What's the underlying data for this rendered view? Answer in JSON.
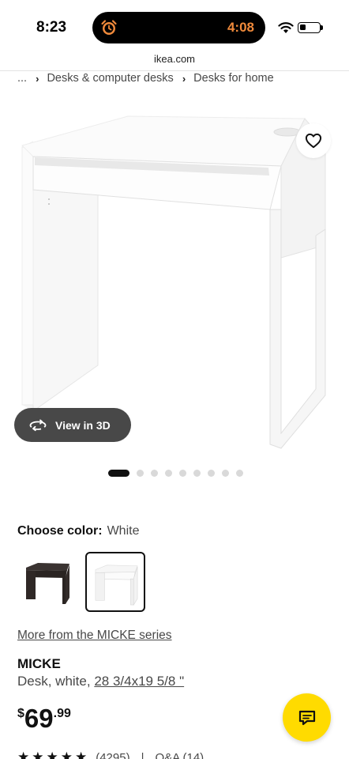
{
  "status_bar": {
    "time": "8:23",
    "timer": "4:08"
  },
  "browser": {
    "url": "ikea.com"
  },
  "breadcrumb": {
    "ellipsis": "...",
    "items": [
      "Desks & computer desks",
      "Desks for home"
    ]
  },
  "gallery": {
    "view_3d_label": "View in 3D",
    "dot_count": 9,
    "active_dot": 0
  },
  "color": {
    "label": "Choose color:",
    "value": "White",
    "options": [
      "Black-brown",
      "White"
    ],
    "selected": "White"
  },
  "series_link": "More from the MICKE series",
  "product": {
    "name": "MICKE",
    "description": "Desk, white,",
    "dimensions": "28 3/4x19 5/8 \""
  },
  "price": {
    "currency": "$",
    "integer": "69",
    "decimal": ".99"
  },
  "reviews": {
    "stars": "★★★★★",
    "count": "(4295)",
    "qa": "Q&A (14)"
  },
  "colors": {
    "chat_button": "#ffdb00",
    "timer": "#f08a3b"
  }
}
